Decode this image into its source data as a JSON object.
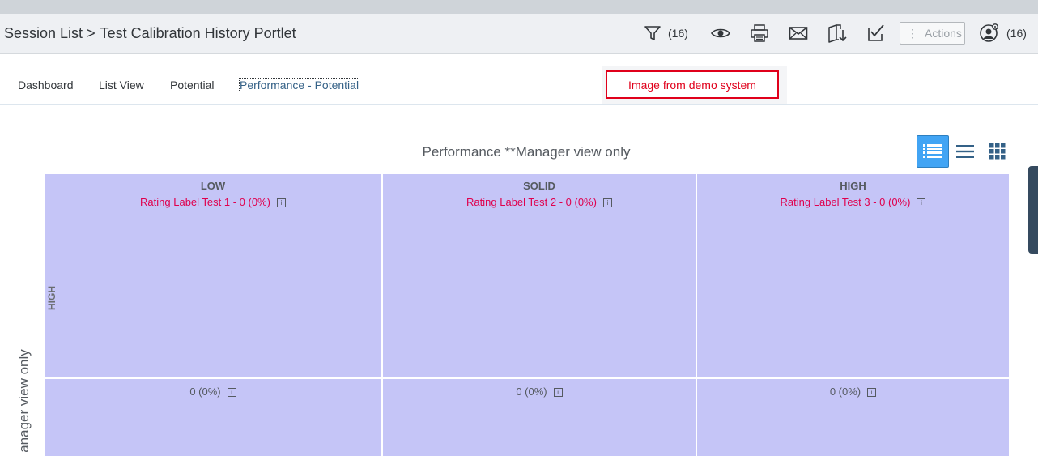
{
  "breadcrumb": {
    "root": "Session List",
    "separator": ">",
    "current": "Test Calibration History Portlet"
  },
  "toolbar": {
    "filter_icon": "filter-icon",
    "filter_count": "(16)",
    "view_icon": "eye-icon",
    "print_icon": "printer-icon",
    "email_icon": "mail-icon",
    "export_icon": "export-icon",
    "approve_icon": "checkbox-icon",
    "actions_label": "Actions",
    "participants_icon": "user-settings-icon",
    "participants_count": "(16)"
  },
  "tabs": [
    {
      "label": "Dashboard"
    },
    {
      "label": "List View"
    },
    {
      "label": "Potential"
    },
    {
      "label": "Performance - Potential",
      "active": true
    }
  ],
  "notice": "Image from demo system",
  "matrix": {
    "title": "Performance **Manager view only",
    "y_axis_title": "anager view only",
    "columns": [
      {
        "label": "LOW",
        "rating": "Rating Label Test 1 - 0 (0%)"
      },
      {
        "label": "SOLID",
        "rating": "Rating Label Test 2 - 0 (0%)"
      },
      {
        "label": "HIGH",
        "rating": "Rating Label Test 3 - 0 (0%)"
      }
    ],
    "rows": [
      {
        "label": "HIGH"
      },
      {
        "cells": [
          "0 (0%)",
          "0 (0%)",
          "0 (0%)"
        ]
      }
    ],
    "info_glyph": "i"
  },
  "view_modes": [
    {
      "icon": "list-detail-icon",
      "active": true
    },
    {
      "icon": "list-icon",
      "active": false
    },
    {
      "icon": "grid-icon",
      "active": false
    }
  ],
  "colors": {
    "cell": "#c5c5f7",
    "accent": "#346187",
    "rating_text": "#e0004d",
    "notice": "#e0001b",
    "active_view": "#41a4f4"
  }
}
